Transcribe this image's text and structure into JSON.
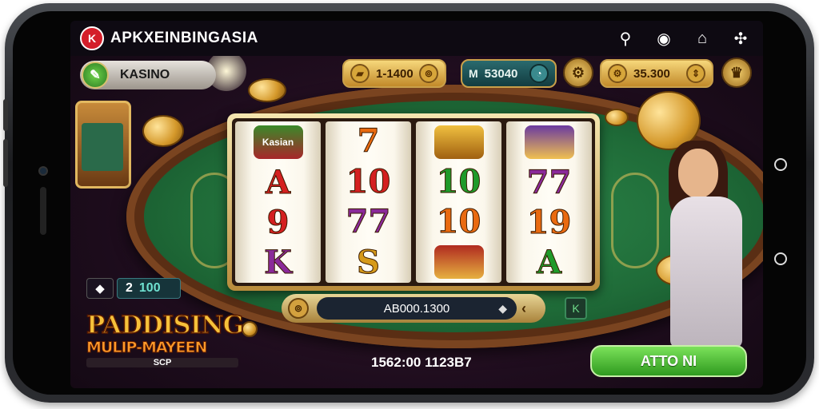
{
  "app": {
    "brand_logo": "K",
    "brand_name": "APKXEINBINGASIA"
  },
  "top_icons": [
    "key-icon",
    "settings-icon",
    "home-icon",
    "bug-icon"
  ],
  "top_icon_glyphs": [
    "⚲",
    "◉",
    "⌂",
    "✣"
  ],
  "header": {
    "kasino_icon": "✎",
    "kasino_label": "KASINO",
    "chip_1": {
      "icon": "▰",
      "value": "1-1400",
      "btn": "⊚"
    },
    "chip_2": {
      "icon": "M",
      "value": "53040",
      "btn": "◔"
    },
    "mid_btn": "⚙",
    "chip_3": {
      "icon": "⚙",
      "value": "35.300",
      "btn": "⇕"
    },
    "right_btn": "♛"
  },
  "reels": [
    [
      {
        "type": "pic",
        "label": "Kasian"
      },
      {
        "type": "text",
        "text": "A",
        "color": "red"
      },
      {
        "type": "text",
        "text": "9",
        "color": "red"
      },
      {
        "type": "text",
        "text": "K",
        "color": "purple"
      }
    ],
    [
      {
        "type": "text",
        "text": "7",
        "color": "orange"
      },
      {
        "type": "text",
        "text": "10",
        "color": "red"
      },
      {
        "type": "text",
        "text": "77",
        "color": "purple"
      },
      {
        "type": "text",
        "text": "S",
        "color": "gold"
      }
    ],
    [
      {
        "type": "pic",
        "label": ""
      },
      {
        "type": "text",
        "text": "10",
        "color": "green"
      },
      {
        "type": "text",
        "text": "10",
        "color": "orange"
      },
      {
        "type": "pic",
        "label": ""
      }
    ],
    [
      {
        "type": "pic",
        "label": ""
      },
      {
        "type": "text",
        "text": "77",
        "color": "purple"
      },
      {
        "type": "text",
        "text": "19",
        "color": "orange"
      },
      {
        "type": "text",
        "text": "A",
        "color": "green"
      }
    ]
  ],
  "bet": {
    "icon": "⊚",
    "value": "AB000.1300",
    "chevron": "‹",
    "side_chip": "K"
  },
  "left_stats": {
    "diamond": "◆",
    "diamond_count": "2",
    "count": "100"
  },
  "promo": {
    "line1": "PADDISING",
    "line2": "MULIP-MAYEEN",
    "sub": "SCP"
  },
  "bottom_value": "1562:00 1123B7",
  "play_button": "ATTO NI",
  "colors": {
    "play_green": "#3fb52a",
    "felt": "#1f6b38",
    "gold": "#d4a03a",
    "brand_red": "#d41e2a"
  }
}
